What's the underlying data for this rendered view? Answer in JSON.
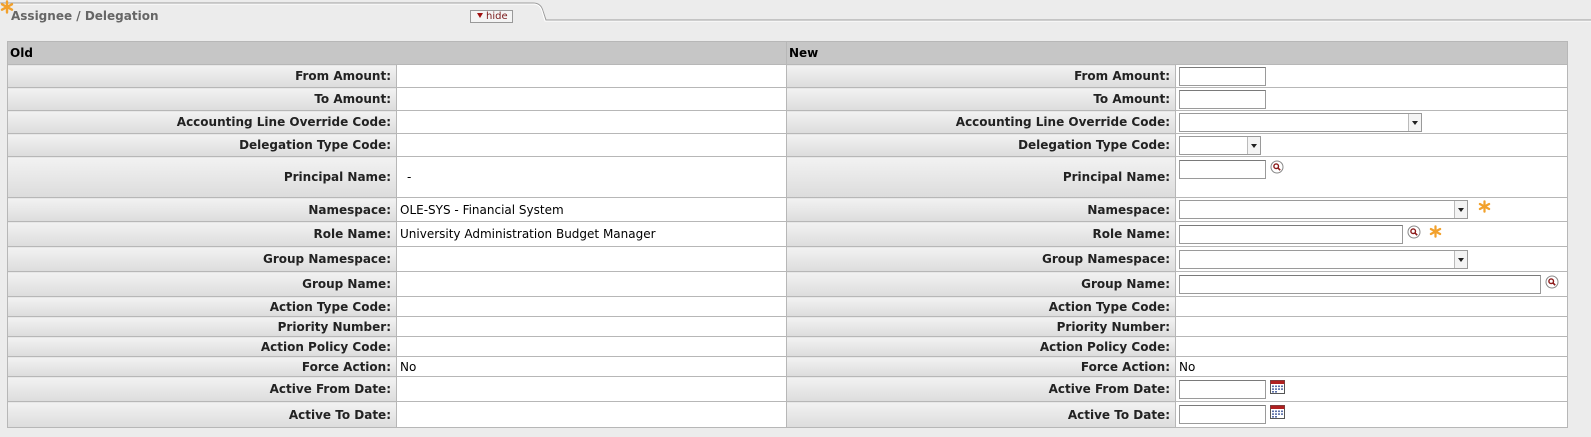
{
  "tab": {
    "title": "Assignee / Delegation",
    "hide_label": "hide",
    "required_icon": "asterisk-icon"
  },
  "columns": {
    "old": "Old",
    "new": "New"
  },
  "rows": [
    {
      "label": "From Amount:",
      "old": "",
      "new_type": "text"
    },
    {
      "label": "To Amount:",
      "old": "",
      "new_type": "text"
    },
    {
      "label": "Accounting Line Override Code:",
      "old": "",
      "new_type": "select",
      "new_value": ""
    },
    {
      "label": "Delegation Type Code:",
      "old": "",
      "new_type": "select",
      "new_value": ""
    },
    {
      "label": "Principal Name:",
      "old": "-",
      "new_type": "text-lookup"
    },
    {
      "label": "Namespace:",
      "old": "OLE-SYS - Financial System",
      "new_type": "select",
      "required": true
    },
    {
      "label": "Role Name:",
      "old": "University Administration Budget Manager",
      "new_type": "text-lookup",
      "required": true
    },
    {
      "label": "Group Namespace:",
      "old": "",
      "new_type": "select"
    },
    {
      "label": "Group Name:",
      "old": "",
      "new_type": "text-lookup"
    },
    {
      "label": "Action Type Code:",
      "old": "",
      "new": ""
    },
    {
      "label": "Priority Number:",
      "old": "",
      "new": ""
    },
    {
      "label": "Action Policy Code:",
      "old": "",
      "new": ""
    },
    {
      "label": "Force Action:",
      "old": "No",
      "new": "No"
    },
    {
      "label": "Active From Date:",
      "old": "",
      "new_type": "date"
    },
    {
      "label": "Active To Date:",
      "old": "",
      "new_type": "date"
    }
  ],
  "colors": {
    "header_bg": "#c6c6c6",
    "required": "#f2a12c",
    "hide_text": "#7a1a1a"
  },
  "icons": {
    "lookup": "magnifier-icon",
    "calendar": "calendar-icon",
    "collapse": "triangle-down-icon"
  }
}
